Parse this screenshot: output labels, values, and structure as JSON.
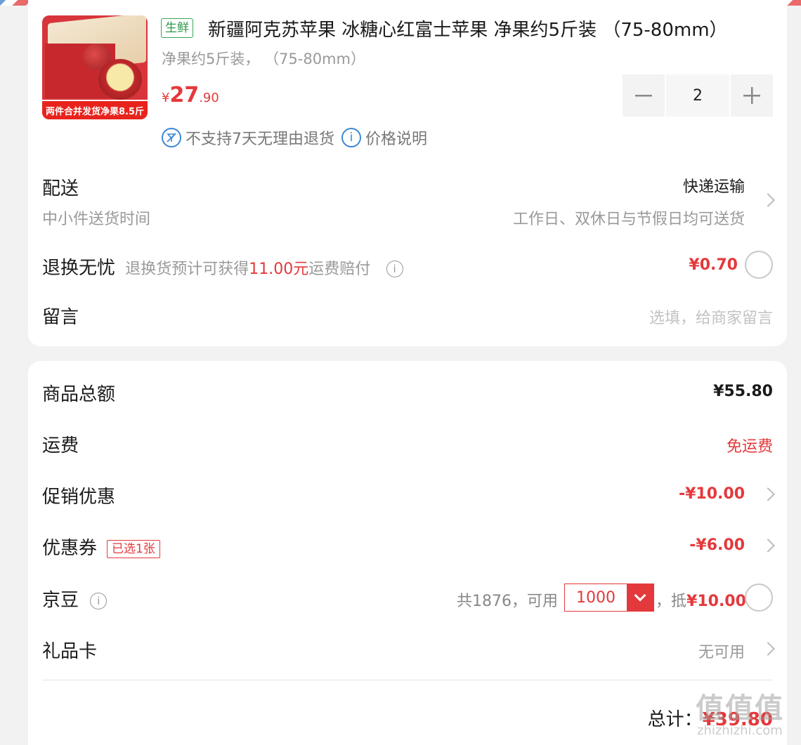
{
  "product": {
    "image_banner": "两件合并发货净果8.5斤",
    "tag": "生鲜",
    "title": "新疆阿克苏苹果 冰糖心红富士苹果 净果约5斤装 （75-80mm）",
    "spec": "净果约5斤装， （75-80mm）",
    "price_symbol": "¥",
    "price_int": "27",
    "price_dec": ".90",
    "quantity": "2",
    "policy_return": "不支持7天无理由退货",
    "policy_price": "价格说明"
  },
  "delivery": {
    "label": "配送",
    "sub": "中小件送货时间",
    "method": "快递运输",
    "desc": "工作日、双休日与节假日均可送货"
  },
  "return_worry": {
    "label": "退换无忧",
    "desc_prefix": "退换货预计可获得",
    "desc_amount": "11.00元",
    "desc_suffix": "运费赔付",
    "price": "¥0.70"
  },
  "message": {
    "label": "留言",
    "placeholder": "选填，给商家留言"
  },
  "summary": {
    "goods_total_label": "商品总额",
    "goods_total": "¥55.80",
    "shipping_label": "运费",
    "shipping_value": "免运费",
    "promo_label": "促销优惠",
    "promo_value": "-¥10.00",
    "coupon_label": "优惠券",
    "coupon_badge": "已选1张",
    "coupon_value": "-¥6.00",
    "beans_label": "京豆",
    "beans_total": "共1876，可用",
    "beans_selected": "1000",
    "beans_comma": "，抵",
    "beans_discount": "¥10.00",
    "giftcard_label": "礼品卡",
    "giftcard_value": "无可用",
    "total_label": "总计：",
    "total_value": "¥39.80"
  },
  "watermark": {
    "main": "值值值",
    "sub": "zhizhizhi.com"
  },
  "colors": {
    "accent": "#e4393c",
    "fresh_tag": "#2f9a48",
    "info_blue": "#3a88d6"
  }
}
